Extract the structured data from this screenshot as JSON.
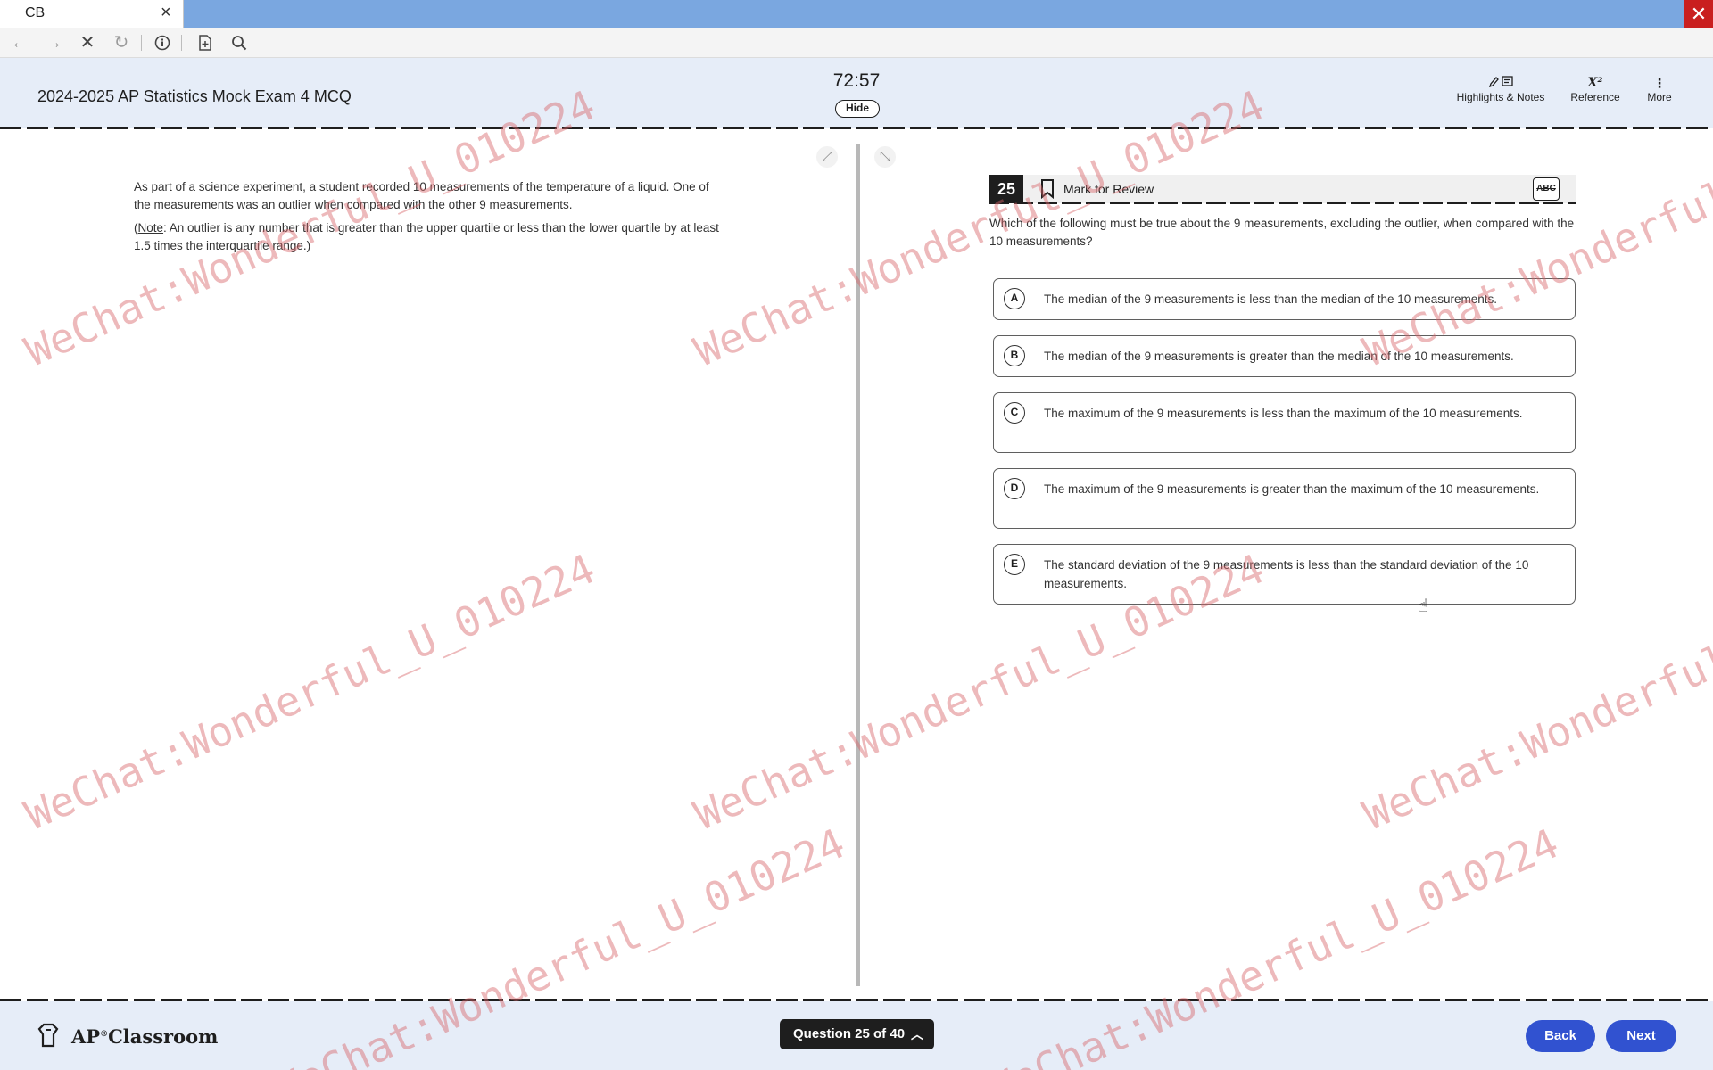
{
  "browser": {
    "tab_title": "CB",
    "tab_close": "×",
    "window_close": "✕"
  },
  "exam": {
    "title": "2024-2025 AP Statistics Mock Exam 4 MCQ",
    "timer": "72:57",
    "hide_label": "Hide",
    "tools": {
      "highlights_label": "Highlights & Notes",
      "reference_label": "Reference",
      "reference_icon_text": "X²",
      "more_label": "More"
    }
  },
  "passage": {
    "paragraph1": "As part of a science experiment, a student recorded 10 measurements of the temperature of a liquid. One of the measurements was an outlier when compared with the other 9 measurements.",
    "note_open": "(",
    "note_label": "Note",
    "note_rest": ": An outlier is any number that is greater than the upper quartile or less than the lower quartile by at least 1.5 times the interquartile range.)"
  },
  "question": {
    "number": "25",
    "mark_for_review": "Mark for Review",
    "abc_label": "ABC",
    "stem": "Which of the following must be true about the 9 measurements, excluding the outlier, when compared with the 10 measurements?",
    "choices": [
      {
        "letter": "A",
        "text": "The median of the 9 measurements is less than the median of the 10 measurements."
      },
      {
        "letter": "B",
        "text": "The median of the 9 measurements is greater than the median of the 10 measurements."
      },
      {
        "letter": "C",
        "text": "The maximum of the 9 measurements is less than the maximum of the 10 measurements."
      },
      {
        "letter": "D",
        "text": "The maximum of the 9 measurements is greater than the maximum of the 10 measurements."
      },
      {
        "letter": "E",
        "text": "The standard deviation of the 9 measurements is less than the standard deviation of the 10 measurements."
      }
    ]
  },
  "footer": {
    "brand_ap": "AP",
    "brand_reg": "®",
    "brand_rest": "Classroom",
    "question_nav": "Question 25 of 40",
    "back_label": "Back",
    "next_label": "Next"
  },
  "watermark": {
    "line1": "WeChat:Wonderful_U_010224",
    "line2": "WeChat:Wonderful_U_010224",
    "line3": "WeChat:Wonderful_U_010224",
    "line4": "WeChat:Wonderful_U_010224",
    "line5": "WeChat:Wonderful_U_010224",
    "line6": "WeChat:Wonderful_U_010224",
    "line7": "WeChat:Wonderful_U_010224",
    "line8": "WeChat:Wonderful_U_010224"
  },
  "colors": {
    "header_bg": "#e6edf8",
    "tabstrip_bg": "#7aa7e0",
    "accent_button": "#3152d0",
    "window_close": "#c91f1f"
  }
}
